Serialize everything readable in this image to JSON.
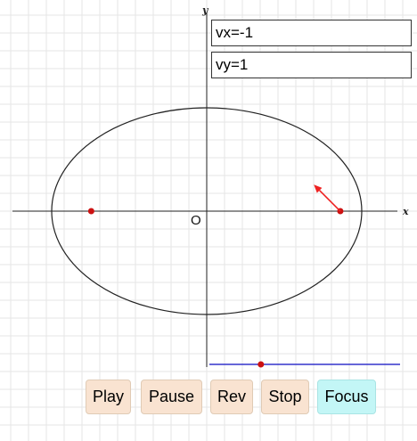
{
  "readouts": {
    "vx": "vx=-1",
    "vy": "vy=1"
  },
  "axes": {
    "x_label": "x",
    "y_label": "y",
    "origin_label": "O"
  },
  "ellipse": {
    "semi_major": 6,
    "semi_minor": 4,
    "foci": [
      -4.47,
      4.47
    ]
  },
  "particle": {
    "x": 5.17,
    "y": 0,
    "vx": -1,
    "vy": 1
  },
  "slider": {
    "value": 0.27
  },
  "controls": {
    "play": "Play",
    "pause": "Pause",
    "rev": "Rev",
    "stop": "Stop",
    "focus": "Focus"
  },
  "colors": {
    "grid": "#e6e6e6",
    "axis": "#222222",
    "ellipse": "#222222",
    "point": "#cc1111",
    "arrow": "#ee2222",
    "slider": "#3333cc",
    "button": "#f9e3d1",
    "focus_button": "#c3f6f6"
  }
}
